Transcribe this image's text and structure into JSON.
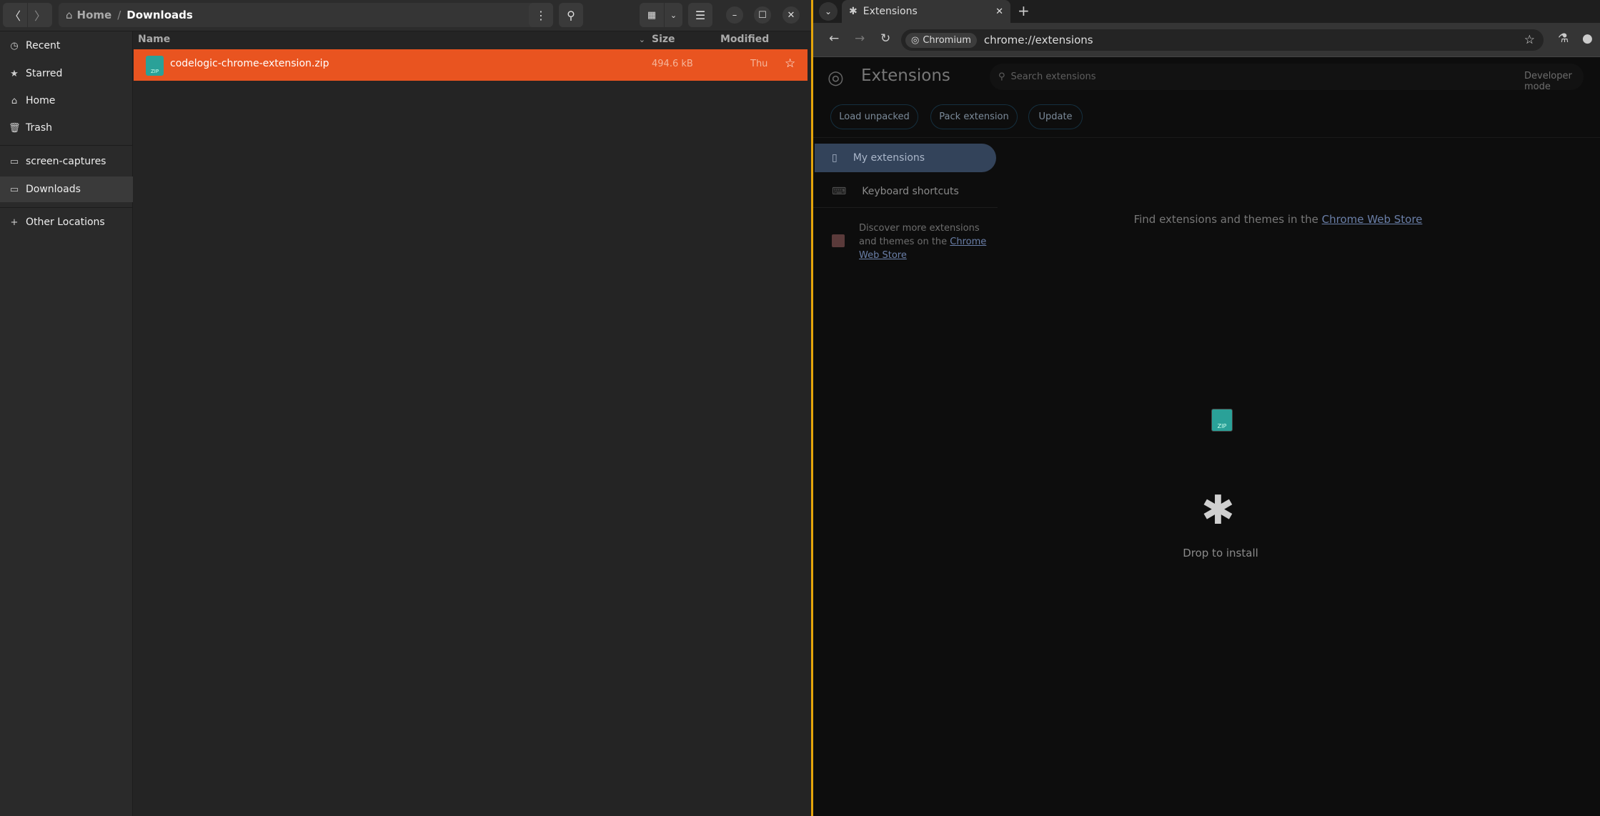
{
  "file_manager": {
    "breadcrumb": {
      "home": "Home",
      "separator": "/",
      "current": "Downloads"
    },
    "sidebar": [
      {
        "label": "Recent",
        "icon": "clock-icon"
      },
      {
        "label": "Starred",
        "icon": "star-icon"
      },
      {
        "label": "Home",
        "icon": "home-icon"
      },
      {
        "label": "Trash",
        "icon": "trash-icon"
      },
      {
        "label": "screen-captures",
        "icon": "folder-icon"
      },
      {
        "label": "Downloads",
        "icon": "folder-icon",
        "selected": true
      },
      {
        "label": "Other Locations",
        "icon": "plus-icon"
      }
    ],
    "columns": {
      "name": "Name",
      "size": "Size",
      "modified": "Modified"
    },
    "files": [
      {
        "name": "codelogic-chrome-extension.zip",
        "size": "494.6 kB",
        "modified": "Thu",
        "icon_label": "ZIP",
        "selected": true
      }
    ],
    "selection_color": "#E95420"
  },
  "browser": {
    "tab_title": "Extensions",
    "chip": "Chromium",
    "url": "chrome://extensions",
    "page": {
      "title": "Extensions",
      "search_placeholder": "Search extensions",
      "developer_mode": "Developer mode",
      "buttons": [
        "Load unpacked",
        "Pack extension",
        "Update"
      ],
      "nav": [
        "My extensions",
        "Keyboard shortcuts"
      ],
      "discover": {
        "text": "Discover more extensions and themes on the ",
        "link": "Chrome Web Store"
      },
      "find": {
        "text": "Find extensions and themes in the ",
        "link": "Chrome Web Store"
      },
      "drop_label": "Drop to install",
      "drag_icon_label": "ZIP"
    }
  }
}
